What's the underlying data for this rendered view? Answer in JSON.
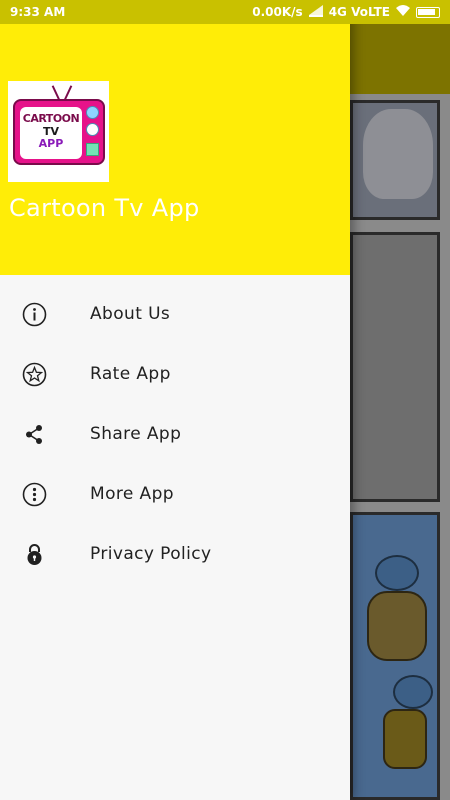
{
  "status_bar": {
    "time": "9:33 AM",
    "network_speed": "0.00K/s",
    "network_type": "4G VoLTE"
  },
  "drawer": {
    "logo": {
      "line1": "CARTOON",
      "line2": "TV",
      "line3": "APP"
    },
    "app_title": "Cartoon Tv App",
    "menu_items": [
      {
        "label": "About Us",
        "icon": "info-icon"
      },
      {
        "label": "Rate App",
        "icon": "star-icon"
      },
      {
        "label": "Share App",
        "icon": "share-icon"
      },
      {
        "label": "More App",
        "icon": "more-vertical-icon"
      },
      {
        "label": "Privacy Policy",
        "icon": "lock-icon"
      }
    ]
  },
  "colors": {
    "drawer_header": "#ffed07",
    "toolbar_dimmed": "#7d7300",
    "drawer_background": "#f7f7f7"
  }
}
